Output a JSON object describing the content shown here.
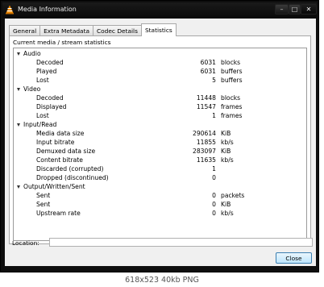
{
  "window": {
    "title": "Media Information",
    "minimize_glyph": "–",
    "maximize_glyph": "□",
    "close_glyph": "✕",
    "icon": "vlc-cone-icon"
  },
  "tabs": [
    {
      "label": "General",
      "active": false
    },
    {
      "label": "Extra Metadata",
      "active": false
    },
    {
      "label": "Codec Details",
      "active": false
    },
    {
      "label": "Statistics",
      "active": true
    }
  ],
  "panel": {
    "label": "Current media / stream statistics",
    "groups": [
      {
        "name": "Audio",
        "rows": [
          {
            "label": "Decoded",
            "value": "6031",
            "unit": "blocks"
          },
          {
            "label": "Played",
            "value": "6031",
            "unit": "buffers"
          },
          {
            "label": "Lost",
            "value": "5",
            "unit": "buffers"
          }
        ]
      },
      {
        "name": "Video",
        "rows": [
          {
            "label": "Decoded",
            "value": "11448",
            "unit": "blocks"
          },
          {
            "label": "Displayed",
            "value": "11547",
            "unit": "frames"
          },
          {
            "label": "Lost",
            "value": "1",
            "unit": "frames"
          }
        ]
      },
      {
        "name": "Input/Read",
        "rows": [
          {
            "label": "Media data size",
            "value": "290614",
            "unit": "KiB"
          },
          {
            "label": "Input bitrate",
            "value": "11855",
            "unit": "kb/s"
          },
          {
            "label": "Demuxed data size",
            "value": "283097",
            "unit": "KiB"
          },
          {
            "label": "Content bitrate",
            "value": "11635",
            "unit": "kb/s"
          },
          {
            "label": "Discarded (corrupted)",
            "value": "1",
            "unit": ""
          },
          {
            "label": "Dropped (discontinued)",
            "value": "0",
            "unit": ""
          }
        ]
      },
      {
        "name": "Output/Written/Sent",
        "rows": [
          {
            "label": "Sent",
            "value": "0",
            "unit": "packets"
          },
          {
            "label": "Sent",
            "value": "0",
            "unit": "KiB"
          },
          {
            "label": "Upstream rate",
            "value": "0",
            "unit": "kb/s"
          }
        ]
      }
    ]
  },
  "location": {
    "label": "Location:",
    "value": ""
  },
  "close_button": {
    "label": "Close"
  },
  "caption": "618x523 40kb PNG"
}
